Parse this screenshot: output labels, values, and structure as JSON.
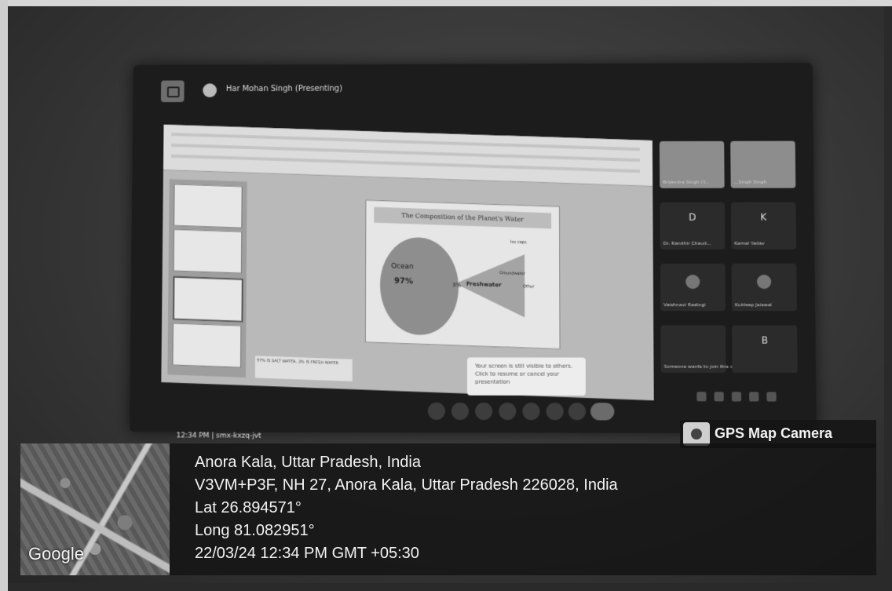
{
  "meet": {
    "presenter": "Har Mohan Singh (Presenting)",
    "time": "12:34 PM",
    "meeting_code": "smx-kxzq-jvt",
    "toast_text": "Your screen is still visible to others. Click to resume or cancel your presentation",
    "participants": [
      {
        "initial": "",
        "name": "Brijendra Singh (Y..."
      },
      {
        "initial": "",
        "name": "...Singh Singh"
      },
      {
        "initial": "D",
        "name": "Dr. Randhir Chaud..."
      },
      {
        "initial": "K",
        "name": "Kamal Yadav"
      },
      {
        "initial": "",
        "name": "Vaishnavi Rastogi"
      },
      {
        "initial": "",
        "name": "Kuldeep Jaiswal"
      },
      {
        "initial": "",
        "name": "Someone wants to join this call"
      },
      {
        "initial": "B",
        "name": ""
      }
    ]
  },
  "slide": {
    "title": "The Composition of the Planet's Water",
    "labels": {
      "ocean": "Ocean",
      "ocean_pct": "97%",
      "freshwater": "Freshwater",
      "small_pct": "3%",
      "ice": "Ice caps",
      "groundwater": "Groundwater",
      "other": "Other"
    },
    "notes": "97% IS SALT WATER, 3% IS FRESH WATER"
  },
  "gps": {
    "app_name": "GPS Map Camera",
    "map_brand": "Google",
    "place": "Anora Kala, Uttar Pradesh, India",
    "address": "V3VM+P3F, NH 27, Anora Kala, Uttar Pradesh 226028, India",
    "lat": "Lat 26.894571°",
    "long": "Long 81.082951°",
    "datetime": "22/03/24 12:34 PM GMT +05:30"
  }
}
